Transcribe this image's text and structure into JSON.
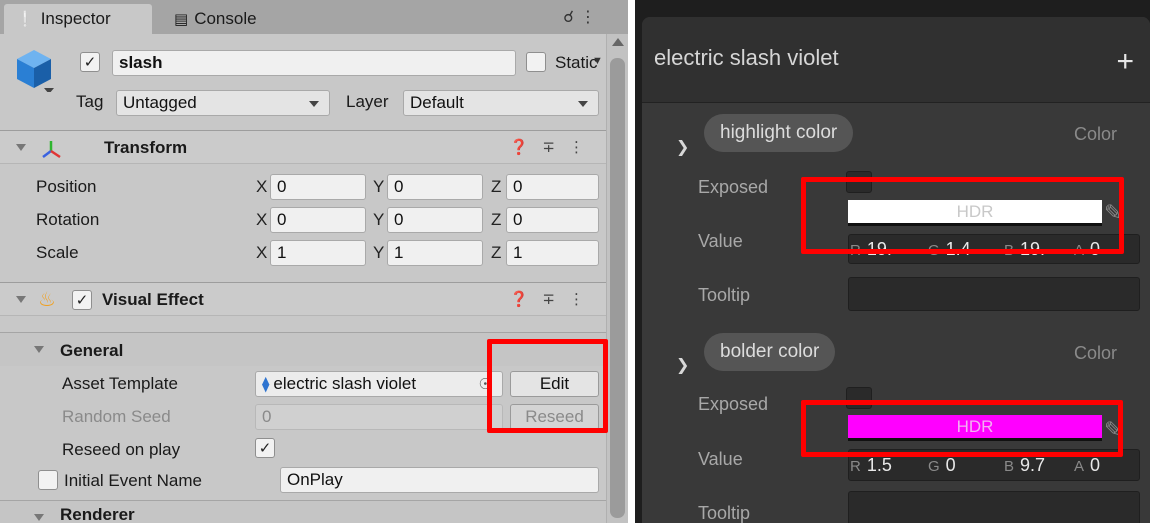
{
  "inspector": {
    "tabs": [
      {
        "icon": "info-icon",
        "label": "Inspector",
        "active": true
      },
      {
        "icon": "console-icon",
        "label": "Console",
        "active": false
      }
    ],
    "gameobject": {
      "name": "slash",
      "active_checked": true,
      "static_label": "Static",
      "tag_label": "Tag",
      "tag_value": "Untagged",
      "layer_label": "Layer",
      "layer_value": "Default"
    },
    "transform": {
      "title": "Transform",
      "rows": [
        {
          "label": "Position",
          "x": "0",
          "y": "0",
          "z": "0"
        },
        {
          "label": "Rotation",
          "x": "0",
          "y": "0",
          "z": "0"
        },
        {
          "label": "Scale",
          "x": "1",
          "y": "1",
          "z": "1"
        }
      ],
      "axes": [
        "X",
        "Y",
        "Z"
      ]
    },
    "visual_effect": {
      "title": "Visual Effect",
      "enabled": true,
      "general_title": "General",
      "asset_template_label": "Asset Template",
      "asset_template_value": "electric slash violet",
      "edit_button": "Edit",
      "random_seed_label": "Random Seed",
      "random_seed_value": "0",
      "reseed_button": "Reseed",
      "reseed_on_play_label": "Reseed on play",
      "reseed_on_play_checked": true,
      "initial_event_label": "Initial Event Name",
      "initial_event_value": "OnPlay",
      "renderer_title": "Renderer"
    }
  },
  "blackboard": {
    "title": "electric slash violet",
    "add_label": "+",
    "properties": [
      {
        "name": "highlight color",
        "type": "Color",
        "exposed_label": "Exposed",
        "value_label": "Value",
        "tooltip_label": "Tooltip",
        "swatch_text": "HDR",
        "swatch_color": "#ffffff",
        "channels": [
          {
            "k": "R",
            "v": "19."
          },
          {
            "k": "G",
            "v": "1.4"
          },
          {
            "k": "B",
            "v": "19."
          },
          {
            "k": "A",
            "v": "0"
          }
        ]
      },
      {
        "name": "bolder color",
        "type": "Color",
        "exposed_label": "Exposed",
        "value_label": "Value",
        "tooltip_label": "Tooltip",
        "swatch_text": "HDR",
        "swatch_color": "#ff00ff",
        "channels": [
          {
            "k": "R",
            "v": "1.5"
          },
          {
            "k": "G",
            "v": "0"
          },
          {
            "k": "B",
            "v": "9.7"
          },
          {
            "k": "A",
            "v": "0"
          }
        ]
      }
    ]
  },
  "colors": {
    "highlight_red": "#ff0000",
    "hdr_white": "#ffffff",
    "hdr_magenta": "#ff00ff"
  }
}
